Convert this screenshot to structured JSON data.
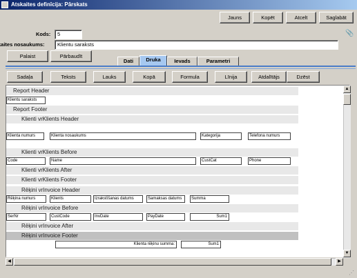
{
  "window": {
    "title": "Atskaites definīcija: Pārskats"
  },
  "toolbar": {
    "new": "Jauns",
    "copy": "Kopēt",
    "cancel": "Atcelt",
    "save": "Saglabāt"
  },
  "form": {
    "code_label": "Kods:",
    "code_value": "5",
    "name_label": "kaites nosaukums:",
    "name_value": "Klientu saraksts"
  },
  "actions": {
    "help": "Palaist",
    "check": "Pārbaudīt"
  },
  "tabs": [
    "Dati",
    "Druka",
    "Ievads",
    "Parametri"
  ],
  "active_tab": "Druka",
  "designer_toolbar": [
    "Sadaļa",
    "Teksts",
    "Lauks",
    "Kopā",
    "Formula",
    "Līnija",
    "Atdalītājs",
    "Dzēst"
  ],
  "bands": [
    {
      "label": "Report Header",
      "level": 1
    },
    {
      "label": "Report Footer",
      "level": 1
    },
    {
      "label": "Klienti vrKlients Header",
      "level": 2
    },
    {
      "label": "Klienti vrKlients Before",
      "level": 2
    },
    {
      "label": "Klienti vrKlients After",
      "level": 2
    },
    {
      "label": "Klienti vrKlients Footer",
      "level": 2
    },
    {
      "label": "Rēķini vrInvoice Header",
      "level": 2
    },
    {
      "label": "Rēķini vrInvoice Before",
      "level": 2
    },
    {
      "label": "Rēķini vrInvoice After",
      "level": 2
    },
    {
      "label": "Rēķini vrInvoice Footer",
      "level": 2
    }
  ],
  "fields": {
    "report_title": "Klientu saraksts",
    "kh_number": "Klienta numurs",
    "kh_name": "Klienta nosaukums",
    "kh_category": "Kategorija",
    "kh_phone": "Telefona numurs",
    "kb_code": "Code",
    "kb_name": "Name",
    "kb_custcat": "CustCat",
    "kb_phone": "Phone",
    "ih_number": "Rēķina numurs",
    "ih_client": "Klients",
    "ih_issue": "Izrakstīšanas datums",
    "ih_pay": "Samaksas datums",
    "ih_sum": "Summa",
    "ib_sernr": "SerNr",
    "ib_custcode": "CustCode",
    "ib_invdate": "InvDate",
    "ib_paydate": "PayDate",
    "ib_sum": "Sum1",
    "if_label": "Klienta rēķinu summa:",
    "if_sum": "Sum1"
  },
  "colors": {
    "titlebar_start": "#0a246a",
    "titlebar_end": "#a6caf0",
    "active_tab": "#a6c8f0",
    "accent_line": "#4a7cc8"
  }
}
